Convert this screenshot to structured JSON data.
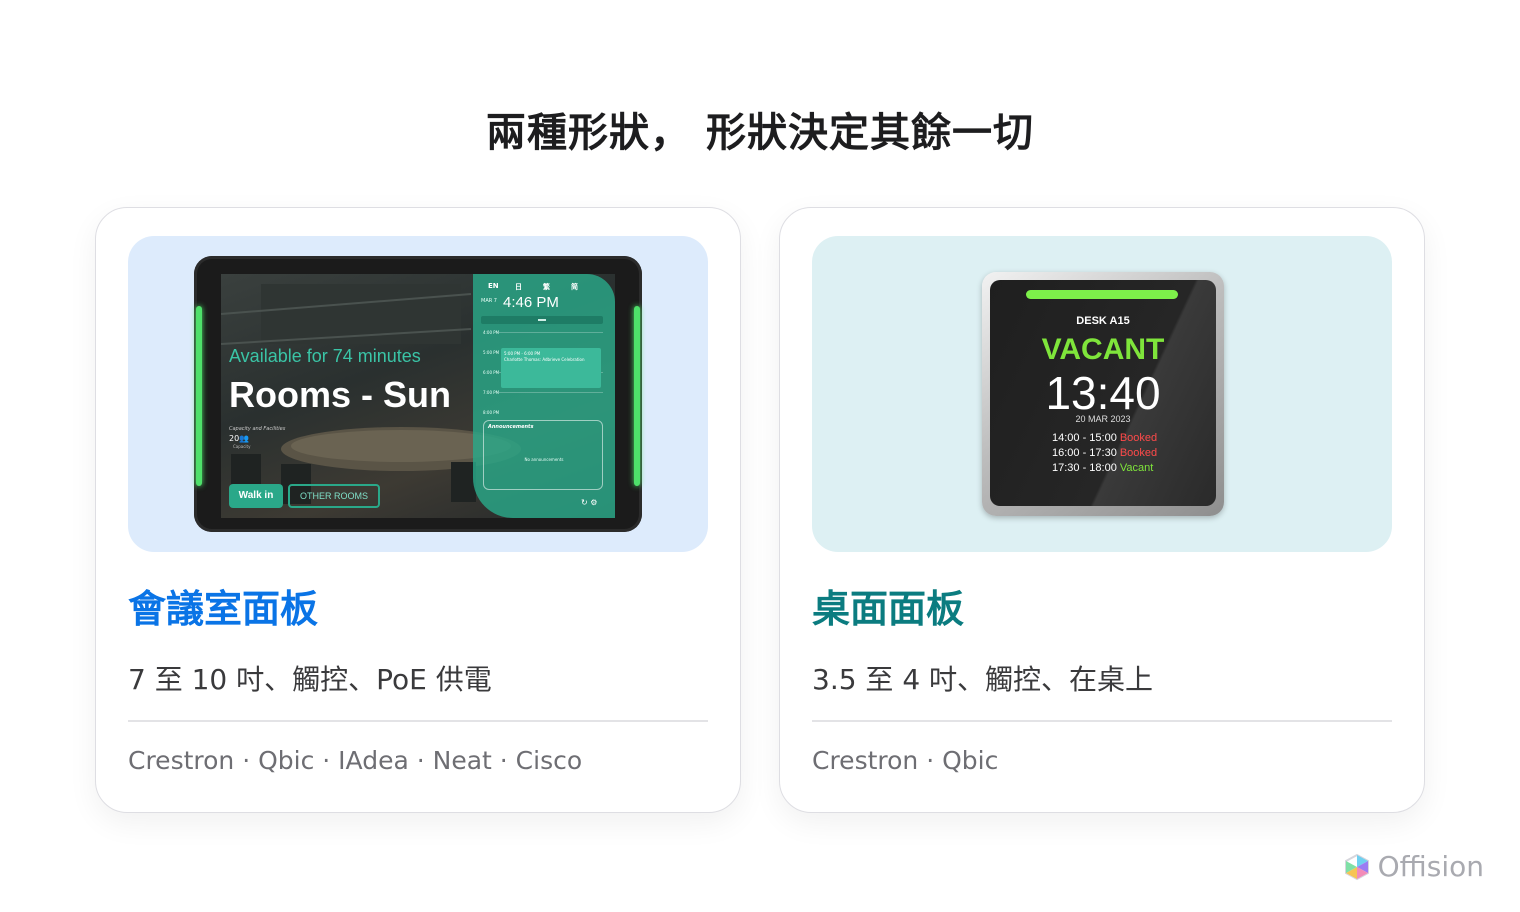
{
  "page": {
    "title": "兩種形狀， 形狀決定其餘一切"
  },
  "cards": [
    {
      "title": "會議室面板",
      "spec": "7 至 10 吋、觸控、PoE 供電",
      "brands": "Crestron · Qbic · IAdea · Neat · Cisco",
      "device": {
        "availability": "Available for 74 minutes",
        "room_name": "Rooms - Sun",
        "capacity_label": "Capacity and Facilities",
        "capacity_value": "20",
        "capacity_sub": "Capacity",
        "walk_in_label": "Walk in",
        "other_rooms_label": "OTHER ROOMS",
        "languages": [
          "EN",
          "日",
          "繁",
          "简"
        ],
        "date": "MAR 7",
        "time": "4:46 PM",
        "slots": [
          "4:00 PM",
          "5:00 PM",
          "6:00 PM",
          "7:00 PM",
          "8:00 PM",
          "9:00 PM"
        ],
        "booking_time": "5:00 PM - 6:00 PM",
        "booking_title": "Charlotte Thomas: Adbrieve Celebration",
        "announcements_title": "Announcements",
        "announcements_empty": "No announcements",
        "accent_color": "#2aa889"
      }
    },
    {
      "title": "桌面面板",
      "spec": "3.5 至 4 吋、觸控、在桌上",
      "brands": "Crestron · Qbic",
      "device": {
        "desk_name": "DESK A15",
        "status": "VACANT",
        "time": "13:40",
        "date": "20 MAR 2023",
        "schedule": [
          {
            "range": "14:00 - 15:00",
            "state": "Booked",
            "color": "#ff4a4a"
          },
          {
            "range": "16:00 - 17:30",
            "state": "Booked",
            "color": "#ff4a4a"
          },
          {
            "range": "17:30 - 18:00",
            "state": "Vacant",
            "color": "#7fe53b"
          }
        ]
      }
    }
  ],
  "brand": {
    "name": "Offision",
    "icon": "offision-logo-icon"
  },
  "colors": {
    "room_accent": "#0a74e6",
    "desk_accent": "#0b7c80"
  }
}
